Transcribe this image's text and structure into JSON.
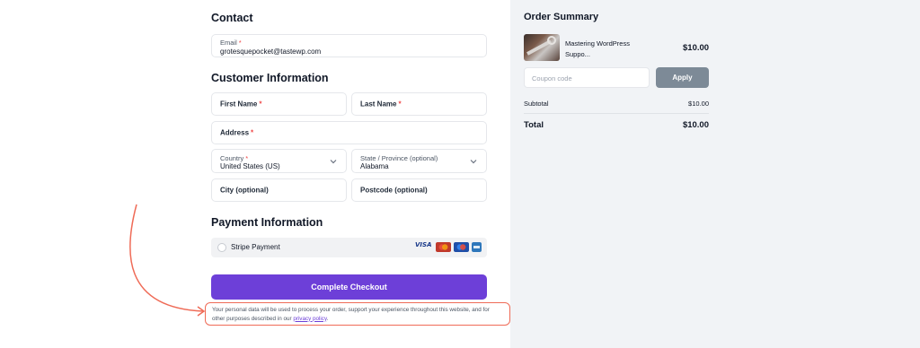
{
  "contact": {
    "heading": "Contact",
    "email_label": "Email",
    "email_value": "grotesquepocket@tastewp.com"
  },
  "customer": {
    "heading": "Customer Information",
    "first_name": "First Name",
    "last_name": "Last Name",
    "address": "Address",
    "country_label": "Country",
    "country_value": "United States (US)",
    "state_label": "State / Province (optional)",
    "state_value": "Alabama",
    "city": "City (optional)",
    "postcode": "Postcode (optional)",
    "required_marker": "*"
  },
  "payment": {
    "heading": "Payment Information",
    "method_label": "Stripe Payment",
    "cards": [
      "VISA",
      "mastercard",
      "maestro",
      "amex"
    ]
  },
  "checkout": {
    "button_label": "Complete Checkout",
    "privacy_text": "Your personal data will be used to process your order, support your experience throughout this website, and for other purposes described in our ",
    "privacy_link": "privacy policy",
    "privacy_end": "."
  },
  "order_summary": {
    "title": "Order Summary",
    "product_name": "Mastering WordPress Suppo...",
    "product_price": "$10.00",
    "coupon_placeholder": "Coupon code",
    "apply_label": "Apply",
    "subtotal_label": "Subtotal",
    "subtotal_value": "$10.00",
    "total_label": "Total",
    "total_value": "$10.00"
  },
  "colors": {
    "accent": "#6d3fd8",
    "annotation": "#ef6b57",
    "summary_bg": "#f1f3f6",
    "apply_bg": "#7d8a97"
  }
}
